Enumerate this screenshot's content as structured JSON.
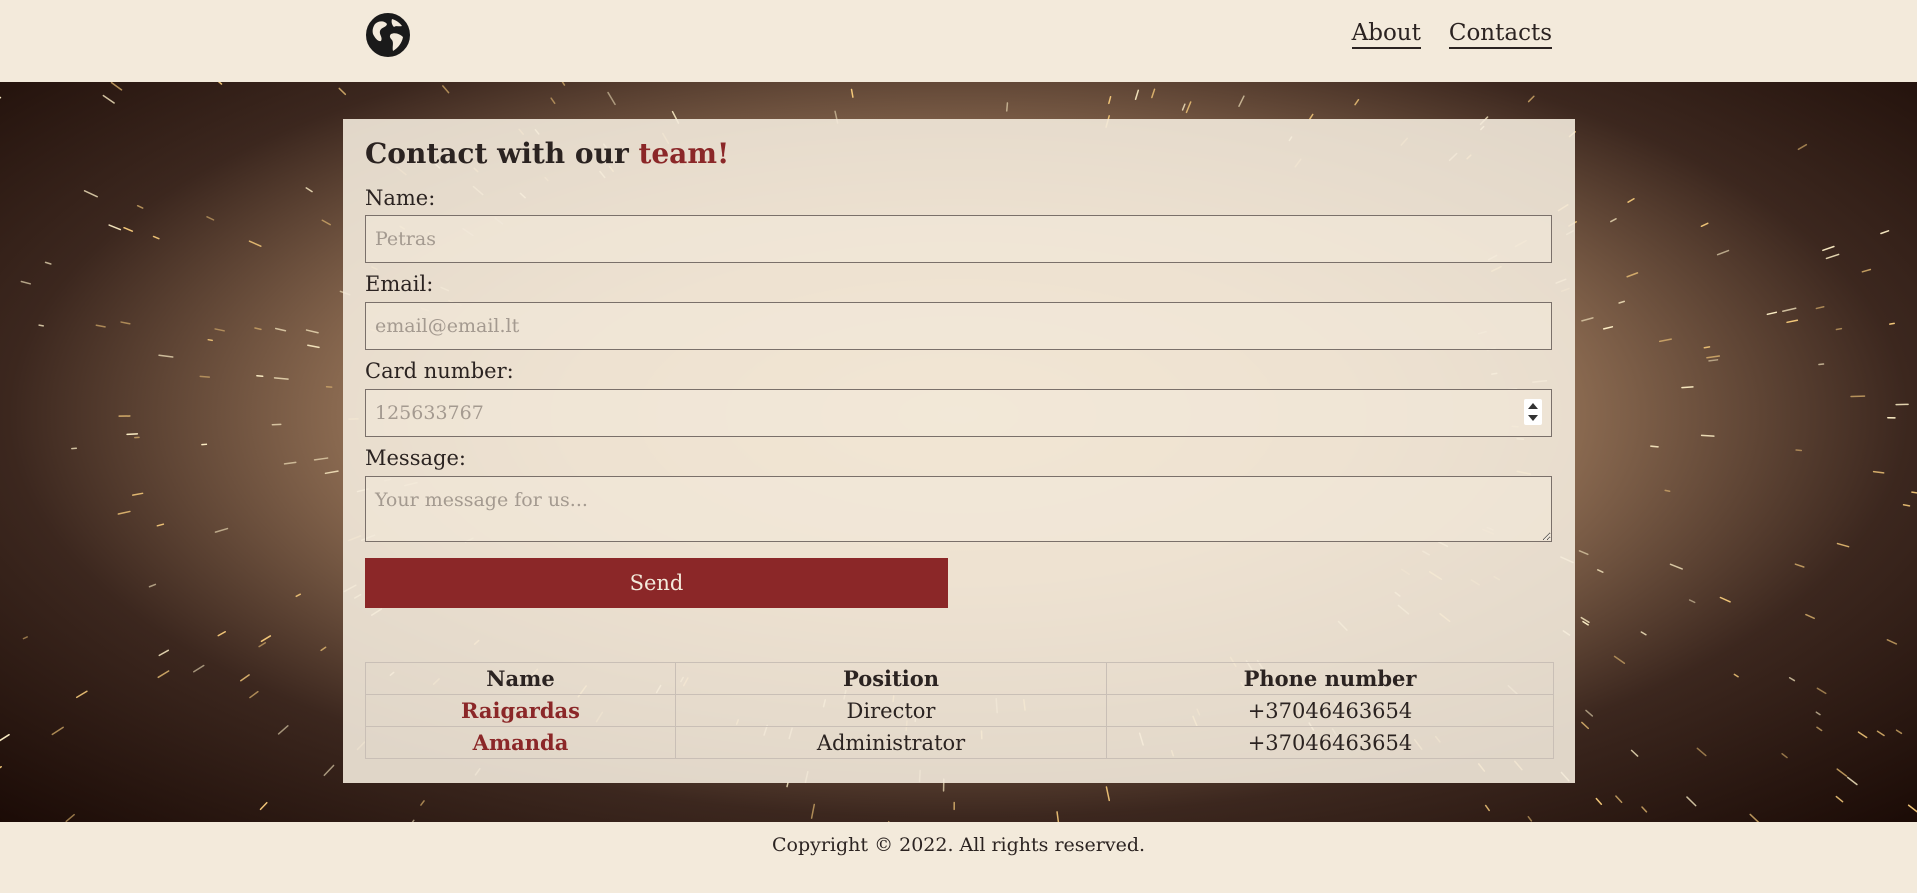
{
  "header": {
    "logo_icon": "globe-icon",
    "nav": [
      {
        "label": "About"
      },
      {
        "label": "Contacts"
      }
    ]
  },
  "form": {
    "title_prefix": "Contact with our ",
    "title_accent": "team!",
    "name_label": "Name:",
    "name_placeholder": "Petras",
    "email_label": "Email:",
    "email_placeholder": "email@email.lt",
    "card_label": "Card number:",
    "card_placeholder": "125633767",
    "message_label": "Message:",
    "message_placeholder": "Your message for us...",
    "send_label": "Send"
  },
  "team_table": {
    "headers": [
      "Name",
      "Position",
      "Phone number"
    ],
    "rows": [
      {
        "name": "Raigardas",
        "position": "Director",
        "phone": "+37046463654"
      },
      {
        "name": "Amanda",
        "position": "Administrator",
        "phone": "+37046463654"
      }
    ]
  },
  "footer": {
    "copyright": "Copyright © 2022. All rights reserved."
  },
  "colors": {
    "background": "#f3eadb",
    "accent": "#8b2728",
    "text": "#2b2321"
  }
}
